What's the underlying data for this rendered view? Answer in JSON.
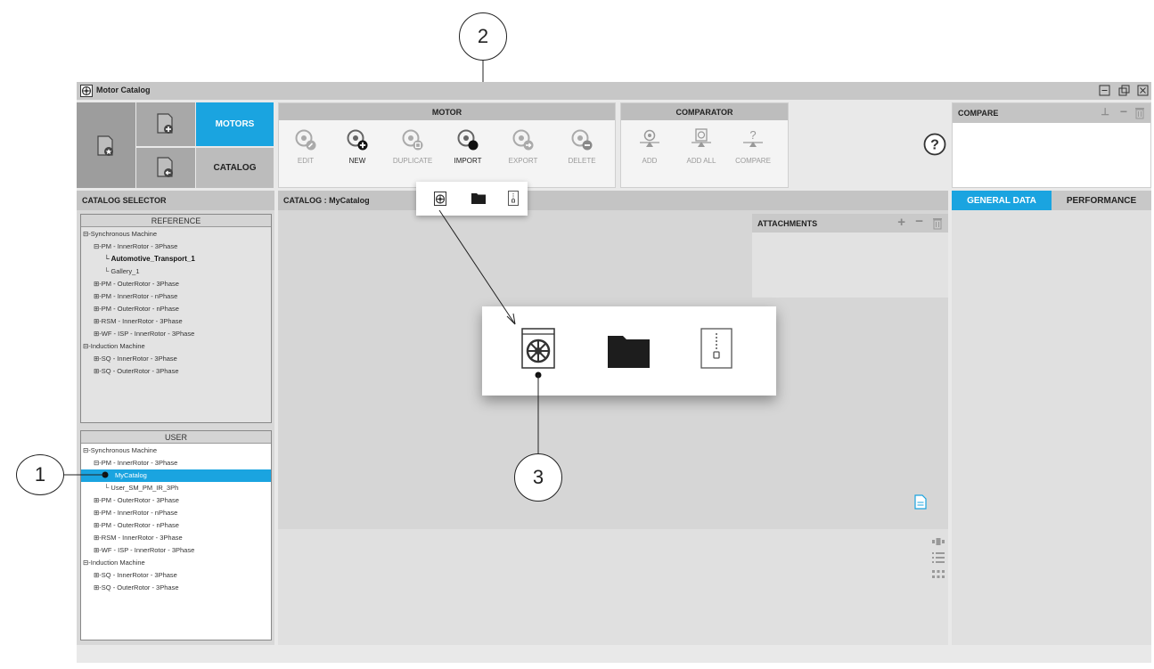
{
  "window": {
    "title": "Motor Catalog"
  },
  "nav": {
    "motors_label": "MOTORS",
    "catalog_label": "CATALOG"
  },
  "motor_group": {
    "title": "MOTOR",
    "buttons": [
      "EDIT",
      "NEW",
      "DUPLICATE",
      "IMPORT",
      "EXPORT",
      "DELETE"
    ]
  },
  "comparator_group": {
    "title": "COMPARATOR",
    "buttons": [
      "ADD",
      "ADD ALL",
      "COMPARE"
    ]
  },
  "compare_panel": {
    "title": "COMPARE"
  },
  "catalog_selector": {
    "title": "CATALOG SELECTOR",
    "reference": {
      "title": "REFERENCE",
      "items": [
        "Synchronous Machine",
        "PM - InnerRotor - 3Phase",
        "Automotive_Transport_1",
        "Gallery_1",
        "PM - OuterRotor - 3Phase",
        "PM - InnerRotor - nPhase",
        "PM - OuterRotor - nPhase",
        "RSM - InnerRotor - 3Phase",
        "WF - ISP - InnerRotor - 3Phase",
        "Induction Machine",
        "SQ - InnerRotor - 3Phase",
        "SQ - OuterRotor - 3Phase"
      ]
    },
    "user": {
      "title": "USER",
      "items": [
        "Synchronous Machine",
        "PM - InnerRotor - 3Phase",
        "MyCatalog",
        "User_SM_PM_IR_3Ph",
        "PM - OuterRotor - 3Phase",
        "PM - InnerRotor - nPhase",
        "PM - OuterRotor - nPhase",
        "RSM - InnerRotor - 3Phase",
        "WF - ISP - InnerRotor - 3Phase",
        "Induction Machine",
        "SQ - InnerRotor - 3Phase",
        "SQ - OuterRotor - 3Phase"
      ]
    }
  },
  "catalog_view": {
    "title": "CATALOG : MyCatalog",
    "attachments_title": "ATTACHMENTS"
  },
  "right_tabs": {
    "general": "GENERAL DATA",
    "performance": "PERFORMANCE"
  },
  "callouts": {
    "one": "1",
    "two": "2",
    "three": "3"
  },
  "colors": {
    "accent": "#1aa4e0"
  }
}
